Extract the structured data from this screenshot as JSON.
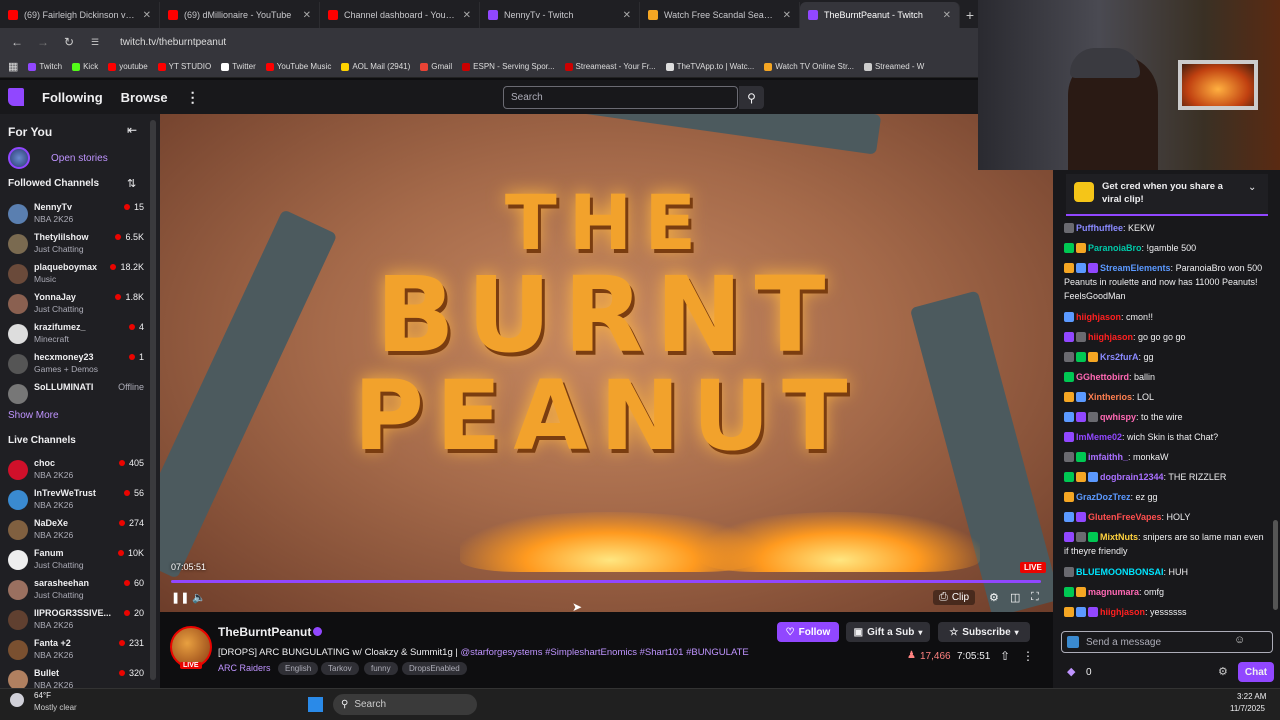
{
  "browser": {
    "tabs": [
      {
        "title": "(69) Fairleigh Dickinson vs. Noti",
        "color": "#ff0000"
      },
      {
        "title": "(69) dMillionaire - YouTube",
        "color": "#ff0000"
      },
      {
        "title": "Channel dashboard - YouTube",
        "color": "#ff0000"
      },
      {
        "title": "NennyTv - Twitch",
        "color": "#9147ff"
      },
      {
        "title": "Watch Free Scandal Season 2 TV",
        "color": "#f5a623"
      },
      {
        "title": "TheBurntPeanut - Twitch",
        "color": "#9147ff"
      }
    ],
    "url": "twitch.tv/theburntpeanut",
    "bookmarks": [
      {
        "label": "Twitch",
        "color": "#9147ff"
      },
      {
        "label": "Kick",
        "color": "#53fc18"
      },
      {
        "label": "youtube",
        "color": "#ff0000"
      },
      {
        "label": "YT STUDIO",
        "color": "#ff0000"
      },
      {
        "label": "Twitter",
        "color": "#ffffff"
      },
      {
        "label": "YouTube Music",
        "color": "#ff0000"
      },
      {
        "label": "AOL Mail (2941)",
        "color": "#ffd400"
      },
      {
        "label": "Gmail",
        "color": "#ea4335"
      },
      {
        "label": "ESPN - Serving Spor...",
        "color": "#cc0000"
      },
      {
        "label": "Streameast - Your Fr...",
        "color": "#cc0000"
      },
      {
        "label": "TheTVApp.to | Watc...",
        "color": "#dddddd"
      },
      {
        "label": "Watch TV Online Str...",
        "color": "#f5a623"
      },
      {
        "label": "Streamed - W",
        "color": "#cccccc"
      }
    ]
  },
  "nav": {
    "following": "Following",
    "browse": "Browse",
    "search_placeholder": "Search"
  },
  "sidebar": {
    "for_you": "For You",
    "open_stories": "Open stories",
    "followed_header": "Followed Channels",
    "followed": [
      {
        "name": "NennyTv",
        "game": "NBA 2K26",
        "viewers": "15",
        "live": true,
        "color": "#5a7fb0"
      },
      {
        "name": "Thetylilshow",
        "game": "Just Chatting",
        "viewers": "6.5K",
        "live": true,
        "color": "#7a6a50"
      },
      {
        "name": "plaqueboymax",
        "game": "Music",
        "viewers": "18.2K",
        "live": true,
        "color": "#6a4a3a"
      },
      {
        "name": "YonnaJay",
        "game": "Just Chatting",
        "viewers": "1.8K",
        "live": true,
        "color": "#8a6050"
      },
      {
        "name": "krazifumez_",
        "game": "Minecraft",
        "viewers": "4",
        "live": true,
        "color": "#dddddd"
      },
      {
        "name": "hecxmoney23",
        "game": "Games + Demos",
        "viewers": "1",
        "live": true,
        "color": "#555555"
      },
      {
        "name": "SoLLUMINATI",
        "game": "",
        "viewers": "Offline",
        "live": false,
        "color": "#777777"
      }
    ],
    "show_more": "Show More",
    "live_header": "Live Channels",
    "live": [
      {
        "name": "choc",
        "game": "NBA 2K26",
        "viewers": "405",
        "color": "#d0102a"
      },
      {
        "name": "InTrevWeTrust",
        "game": "NBA 2K26",
        "viewers": "56",
        "color": "#3a8ad0"
      },
      {
        "name": "NaDeXe",
        "game": "NBA 2K26",
        "viewers": "274",
        "color": "#806040"
      },
      {
        "name": "Fanum",
        "game": "Just Chatting",
        "viewers": "10K",
        "color": "#eeeeee"
      },
      {
        "name": "sarasheehan",
        "game": "Just Chatting",
        "viewers": "60",
        "color": "#9a7060"
      },
      {
        "name": "IIPROGR3SSIVE...",
        "game": "NBA 2K26",
        "viewers": "20",
        "color": "#604030"
      },
      {
        "name": "Fanta +2",
        "game": "NBA 2K26",
        "viewers": "231",
        "color": "#7a5030"
      },
      {
        "name": "Bullet",
        "game": "NBA 2K26",
        "viewers": "320",
        "color": "#b08060"
      }
    ]
  },
  "player": {
    "art_lines": [
      "THE",
      "BURNT",
      "PEANUT"
    ],
    "timecode": "07:05:51",
    "live_badge": "LIVE",
    "clip_label": "Clip",
    "progress": 1.0
  },
  "stream": {
    "channel": "TheBurntPeanut",
    "avatar_live": "LIVE",
    "title": "[DROPS] ARC BUNGULATING w/ Cloakzy & Summit1g |",
    "title_tags": "@starforgesystems #SimpleshartEnomics #Shart101 #BUNGULATE",
    "category": "ARC Raiders",
    "tags": [
      "English",
      "Tarkov",
      "funny",
      "DropsEnabled"
    ],
    "follow": "Follow",
    "gift": "Gift a Sub",
    "subscribe": "Subscribe",
    "viewers": "17,466",
    "uptime": "7:05:51"
  },
  "chat": {
    "cred_text": "Get cred when you share a viral clip!",
    "messages": [
      {
        "user": "Puffhufflee",
        "color": "#8a8aff",
        "text": "KEKW"
      },
      {
        "user": "ParanoiaBro",
        "color": "#00c8a8",
        "text": "!gamble 500"
      },
      {
        "user": "StreamElements",
        "color": "#5b99ff",
        "text": "ParanoiaBro won 500 Peanuts in roulette and now has 11000 Peanuts! FeelsGoodMan"
      },
      {
        "user": "hiighjason",
        "color": "#ff2020",
        "text": "cmon!!"
      },
      {
        "user": "hiighjason",
        "color": "#ff2020",
        "text": "go go go go"
      },
      {
        "user": "Krs2furA",
        "color": "#8a8aff",
        "text": "gg"
      },
      {
        "user": "GGhettobird",
        "color": "#ff69b4",
        "text": "ballin"
      },
      {
        "user": "Xintherios",
        "color": "#ff7f50",
        "text": "LOL"
      },
      {
        "user": "qwhispy",
        "color": "#ff69b4",
        "text": "to the wire"
      },
      {
        "user": "ImMeme02",
        "color": "#9147ff",
        "text": "wich Skin is that Chat?"
      },
      {
        "user": "imfaithh_",
        "color": "#a970ff",
        "text": "monkaW"
      },
      {
        "user": "dogbrain12344",
        "color": "#a970ff",
        "text": "THE RIZZLER"
      },
      {
        "user": "GrazDozTrez",
        "color": "#5b99ff",
        "text": "ez gg"
      },
      {
        "user": "GlutenFreeVapes",
        "color": "#ff4f4f",
        "text": "HOLY"
      },
      {
        "user": "MixtNuts",
        "color": "#ffd23f",
        "text": "snipers are so lame man even if theyre friendly"
      },
      {
        "user": "BLUEMOONBONSAI",
        "color": "#00e5ff",
        "text": "HUH"
      },
      {
        "user": "magnumara",
        "color": "#ff69b4",
        "text": "omfg"
      },
      {
        "user": "hiighjason",
        "color": "#ff2020",
        "text": "yessssss"
      }
    ],
    "input_placeholder": "Send a message",
    "points": "0",
    "chat_button": "Chat"
  },
  "taskbar": {
    "weather_temp": "64°F",
    "weather_desc": "Mostly clear",
    "search": "Search",
    "time": "3:22 AM",
    "date": "11/7/2025"
  }
}
